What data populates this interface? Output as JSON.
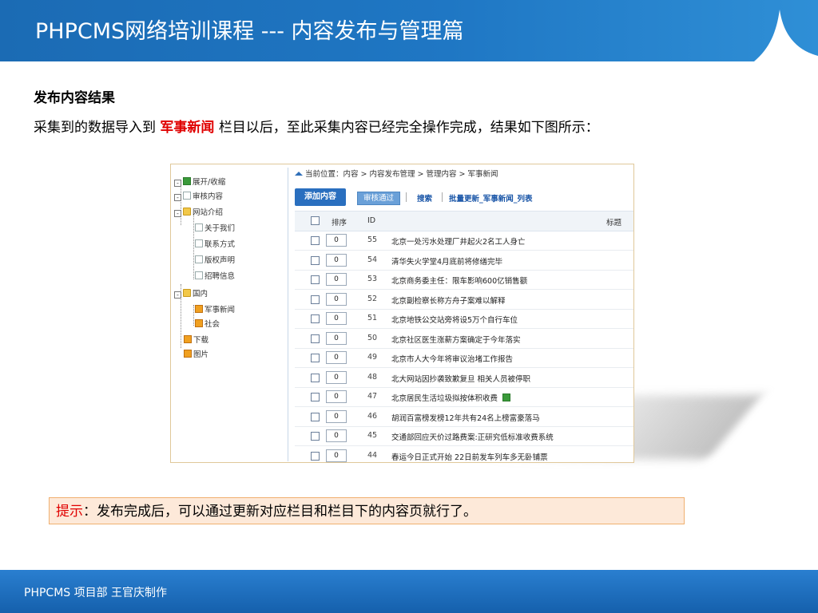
{
  "header": {
    "title": "PHPCMS网络培训课程 --- 内容发布与管理篇"
  },
  "section": {
    "heading": "发布内容结果",
    "intro_before": "采集到的数据导入到",
    "intro_highlight": "军事新闻",
    "intro_after": "栏目以后，至此采集内容已经完全操作完成，结果如下图所示："
  },
  "screenshot": {
    "tree": {
      "toggle": "展开/收缩",
      "audit": "审核内容",
      "site_intro": "网站介绍",
      "about": "关于我们",
      "contact": "联系方式",
      "copyright": "版权声明",
      "jobs": "招聘信息",
      "domestic": "国内",
      "military": "军事新闻",
      "society": "社会",
      "download": "下载",
      "pictures": "图片"
    },
    "breadcrumb": "当前位置：内容 > 内容发布管理 > 管理内容 > 军事新闻",
    "toolbar": {
      "add": "添加内容",
      "audit_pass": "审核通过",
      "search": "搜索",
      "batch_update": "批量更新_军事新闻_列表"
    },
    "columns": {
      "order": "排序",
      "id": "ID",
      "title": "标题"
    },
    "rows": [
      {
        "order": "0",
        "id": "55",
        "title": "北京一处污水处理厂井起火2名工人身亡"
      },
      {
        "order": "0",
        "id": "54",
        "title": "清华失火学堂4月底前将修缮完毕"
      },
      {
        "order": "0",
        "id": "53",
        "title": "北京商务委主任：限车影响600亿销售额"
      },
      {
        "order": "0",
        "id": "52",
        "title": "北京副检察长称方舟子案难以解释"
      },
      {
        "order": "0",
        "id": "51",
        "title": "北京地铁公交站旁将设5万个自行车位"
      },
      {
        "order": "0",
        "id": "50",
        "title": "北京社区医生涨薪方案确定于今年落实"
      },
      {
        "order": "0",
        "id": "49",
        "title": "北京市人大今年将审议治堵工作报告"
      },
      {
        "order": "0",
        "id": "48",
        "title": "北大网站因抄袭致歉复旦 相关人员被停职"
      },
      {
        "order": "0",
        "id": "47",
        "title": "北京居民生活垃圾拟按体积收费"
      },
      {
        "order": "0",
        "id": "46",
        "title": "胡润百富榜发榜12年共有24名上榜富豪落马"
      },
      {
        "order": "0",
        "id": "45",
        "title": "交通部回应天价过路费案:正研究低标准收费系统"
      },
      {
        "order": "0",
        "id": "44",
        "title": "春运今日正式开始 22日前发车列车多无卧铺票"
      }
    ]
  },
  "tip": {
    "label": "提示",
    "text": "：发布完成后，可以通过更新对应栏目和栏目下的内容页就行了。"
  },
  "footer": {
    "text": "PHPCMS 项目部 王官庆制作"
  },
  "colors": {
    "header_blue": "#1f77c4",
    "highlight_red": "#e00000",
    "tip_bg": "#fde9d9",
    "tip_border": "#f0b070"
  }
}
